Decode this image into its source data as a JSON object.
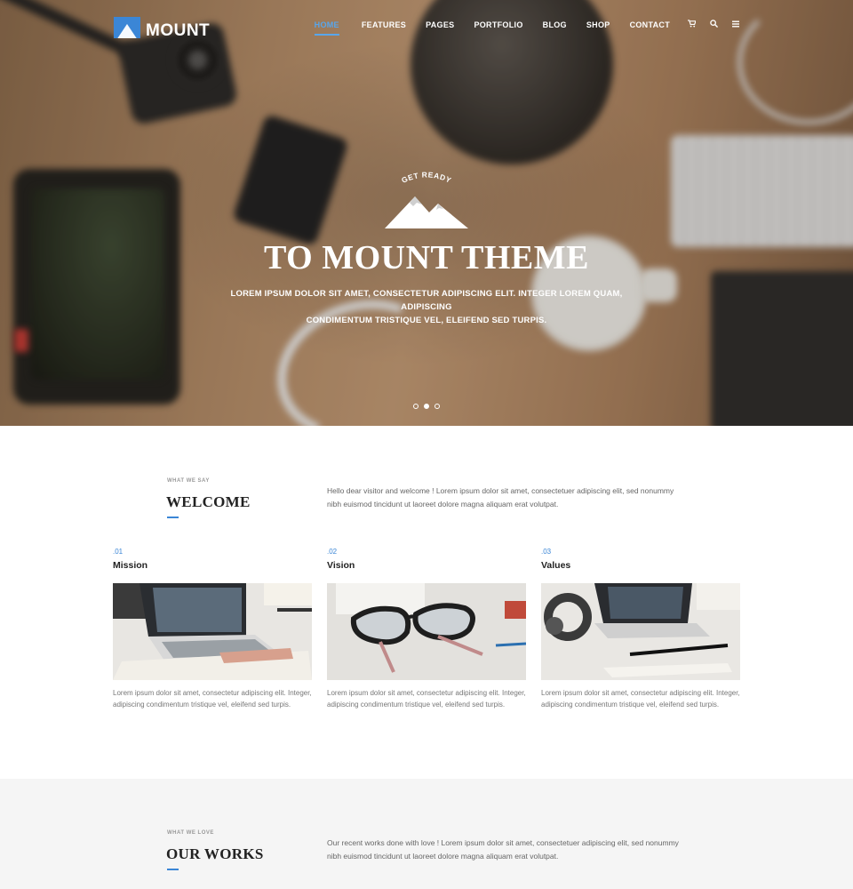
{
  "brand": {
    "name": "MOUNT",
    "accent": "#3b86d6",
    "nav_active": "#58a6ec"
  },
  "nav": {
    "items": [
      {
        "label": "HOME",
        "active": true
      },
      {
        "label": "FEATURES",
        "active": false
      },
      {
        "label": "PAGES",
        "active": false
      },
      {
        "label": "PORTFOLIO",
        "active": false
      },
      {
        "label": "BLOG",
        "active": false
      },
      {
        "label": "SHOP",
        "active": false
      },
      {
        "label": "CONTACT",
        "active": false
      }
    ],
    "icons": [
      "cart-icon",
      "search-icon",
      "menu-icon"
    ]
  },
  "hero": {
    "eyebrow": "GET READY",
    "title": "TO MOUNT THEME",
    "subtitle_line1": "LOREM IPSUM DOLOR SIT AMET, CONSECTETUR ADIPISCING ELIT. INTEGER LOREM QUAM, ADIPISCING",
    "subtitle_line2": "CONDIMENTUM TRISTIQUE VEL, ELEIFEND SED TURPIS.",
    "slides": 3,
    "active_slide": 2
  },
  "welcome": {
    "eyebrow": "WHAT WE SAY",
    "title": "WELCOME",
    "text_line1": "Hello dear visitor and welcome ! Lorem ipsum dolor sit amet, consectetuer adipiscing elit, sed nonummy",
    "text_line2": "nibh euismod tincidunt ut laoreet dolore magna aliquam erat volutpat."
  },
  "features": [
    {
      "num": ".01",
      "title": "Mission",
      "image": "laptop-newspaper-image",
      "text": "Lorem ipsum dolor sit amet, consectetur adipiscing elit. Integer, adipiscing condimentum tristique vel, eleifend sed turpis."
    },
    {
      "num": ".02",
      "title": "Vision",
      "image": "glasses-image",
      "text": "Lorem ipsum dolor sit amet, consectetur adipiscing elit. Integer, adipiscing condimentum tristique vel, eleifend sed turpis."
    },
    {
      "num": ".03",
      "title": "Values",
      "image": "headphones-laptop-image",
      "text": "Lorem ipsum dolor sit amet, consectetur adipiscing elit. Integer, adipiscing condimentum tristique vel, eleifend sed turpis."
    }
  ],
  "works": {
    "eyebrow": "WHAT WE LOVE",
    "title": "OUR WORKS",
    "text_line1": "Our recent works done with love ! Lorem ipsum dolor sit amet, consectetuer adipiscing elit, sed nonummy",
    "text_line2": "nibh euismod tincidunt ut laoreet dolore magna aliquam erat volutpat."
  }
}
